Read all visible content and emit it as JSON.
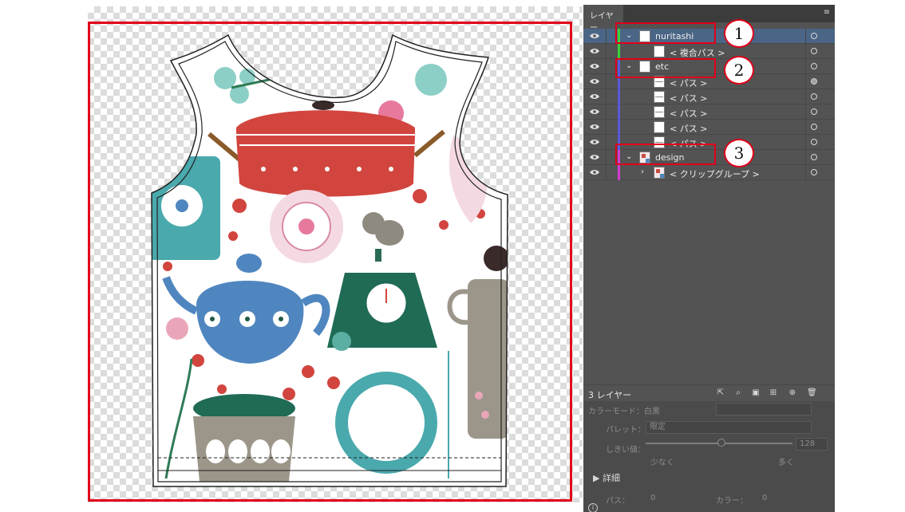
{
  "panel": {
    "tab_label": "レイヤー",
    "menu_icon": "hamburger-menu-icon",
    "layer_count": "3 レイヤー"
  },
  "layers": [
    {
      "name": "nuritashi",
      "level": 0,
      "expanded": true,
      "color": "#3cd23c",
      "selected": true,
      "thumb": "white"
    },
    {
      "name": "< 複合パス >",
      "level": 1,
      "color": "#3cd23c",
      "thumb": "white"
    },
    {
      "name": "etc",
      "level": 0,
      "expanded": true,
      "color": "#5a5adc",
      "thumb": "white"
    },
    {
      "name": "< パス >",
      "level": 1,
      "color": "#5a5adc",
      "thumb": "line",
      "target_filled": true
    },
    {
      "name": "< パス >",
      "level": 1,
      "color": "#5a5adc",
      "thumb": "line"
    },
    {
      "name": "< パス >",
      "level": 1,
      "color": "#5a5adc",
      "thumb": "line"
    },
    {
      "name": "< パス >",
      "level": 1,
      "color": "#5a5adc",
      "thumb": "white"
    },
    {
      "name": "< パス >",
      "level": 1,
      "color": "#5a5adc",
      "thumb": "line"
    },
    {
      "name": "design",
      "level": 0,
      "expanded": true,
      "color": "#d23cd2",
      "thumb": "design"
    },
    {
      "name": "< クリップグループ >",
      "level": 1,
      "color": "#d23cd2",
      "thumb": "design",
      "collapsed_arrow": true
    }
  ],
  "callouts": [
    "1",
    "2",
    "3"
  ],
  "lower_panel": {
    "color_mode_label": "カラーモード：白黒",
    "palette_label": "パレット：",
    "palette_value": "限定",
    "threshold_label": "しきい値：",
    "threshold_value": "128",
    "less_label": "少なく",
    "more_label": "多く",
    "details_label": "詳細",
    "paths_label": "パス：",
    "paths_value": "0",
    "colors_label": "カラー：",
    "colors_value": "0"
  },
  "colors": {
    "frame_red": "#e0001a",
    "panel_bg": "#535353",
    "selected_row": "#4a6585"
  }
}
